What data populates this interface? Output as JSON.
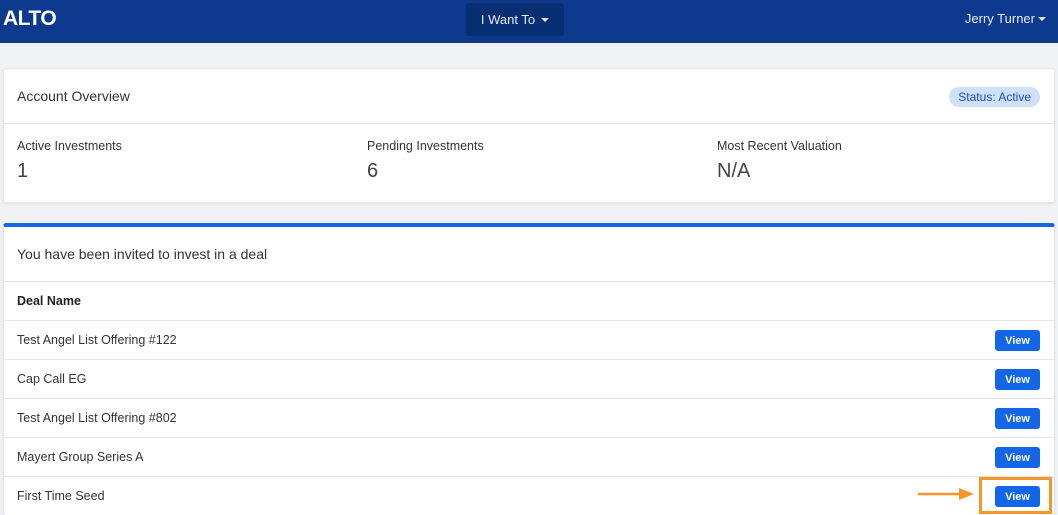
{
  "navbar": {
    "logo": "ALTO",
    "want_menu": "I Want To",
    "user_name": "Jerry Turner"
  },
  "overview": {
    "title": "Account Overview",
    "status": "Status: Active",
    "stats": [
      {
        "label": "Active Investments",
        "value": "1"
      },
      {
        "label": "Pending Investments",
        "value": "6"
      },
      {
        "label": "Most Recent Valuation",
        "value": "N/A"
      }
    ]
  },
  "deals": {
    "title": "You have been invited to invest in a deal",
    "column_header": "Deal Name",
    "view_label": "View",
    "rows": [
      {
        "name": "Test Angel List Offering #122"
      },
      {
        "name": "Cap Call EG"
      },
      {
        "name": "Test Angel List Offering #802"
      },
      {
        "name": "Mayert Group Series A"
      },
      {
        "name": "First Time Seed"
      }
    ]
  },
  "colors": {
    "navbar": "#0d3a8c",
    "accent": "#1466e8",
    "highlight": "#f3962c"
  }
}
